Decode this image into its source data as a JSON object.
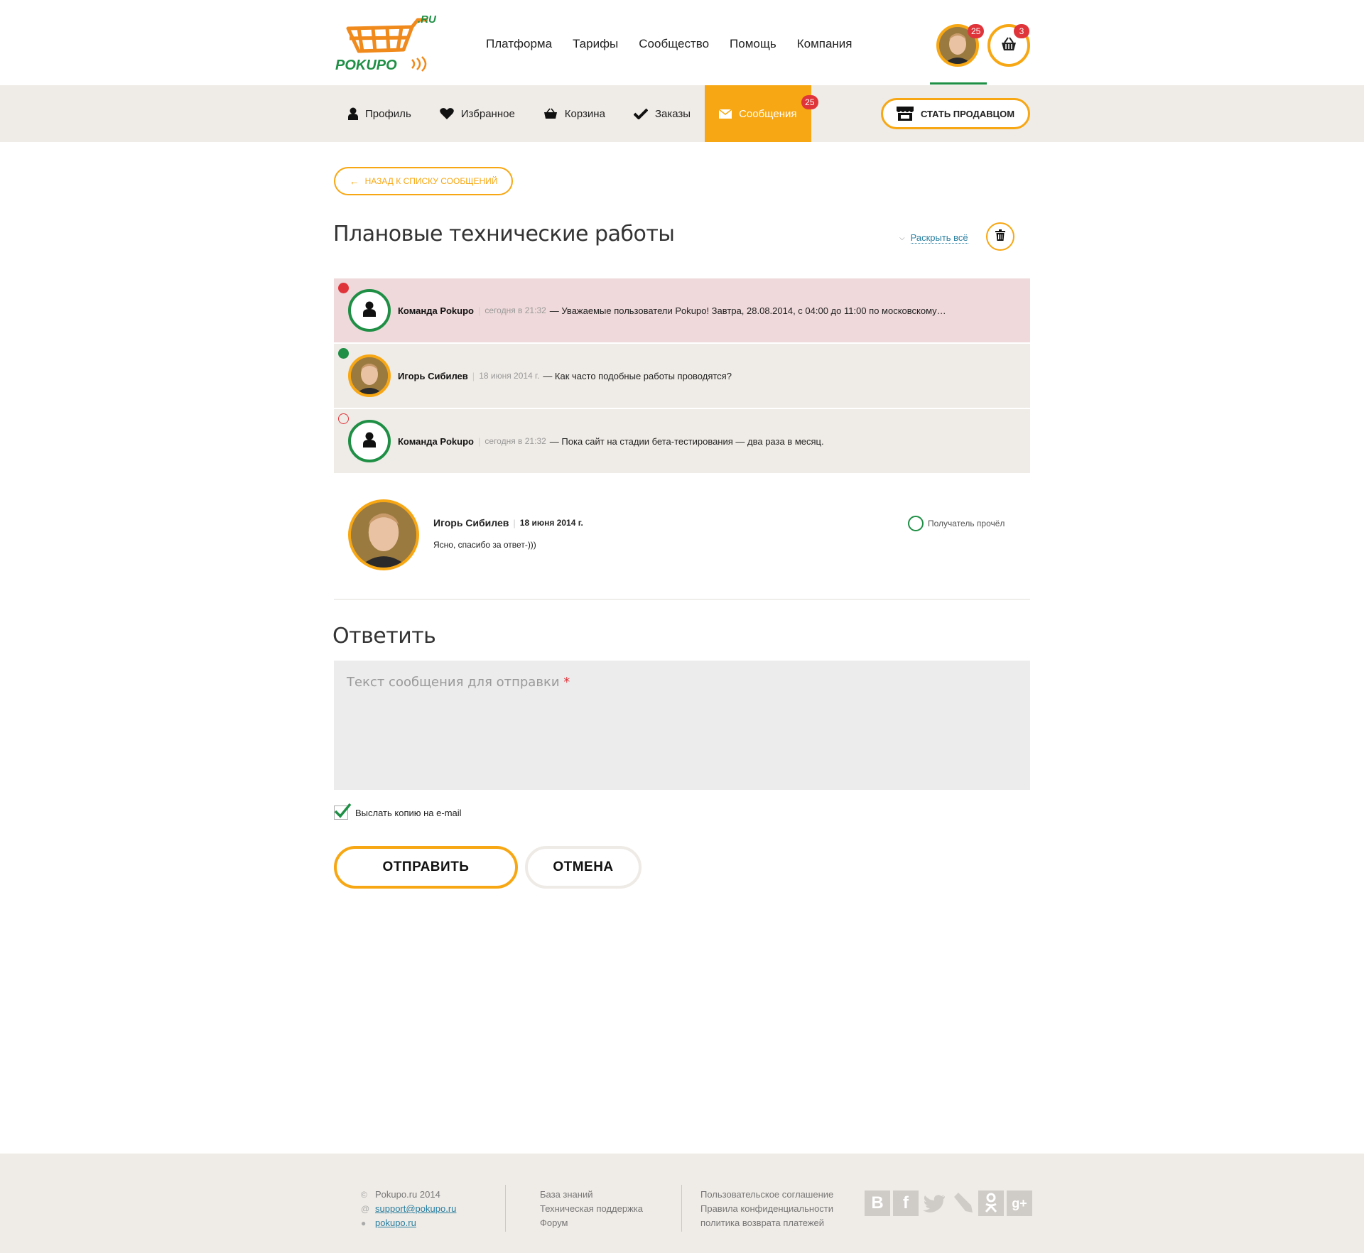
{
  "logo": {
    "text": "POKUPO",
    "suffix": ".RU"
  },
  "topnav": [
    "Платформа",
    "Тарифы",
    "Сообщество",
    "Помощь",
    "Компания"
  ],
  "user": {
    "badge": "25"
  },
  "cart": {
    "badge": "3"
  },
  "subnav": {
    "tabs": [
      {
        "label": "Профиль",
        "icon": "user-icon"
      },
      {
        "label": "Избранное",
        "icon": "heart-icon"
      },
      {
        "label": "Корзина",
        "icon": "basket-icon"
      },
      {
        "label": "Заказы",
        "icon": "check-icon"
      },
      {
        "label": "Сообщения",
        "icon": "envelope-icon",
        "active": true,
        "badge": "25"
      }
    ],
    "seller_button": "СТАТЬ ПРОДАВЦОМ"
  },
  "back_button": "НАЗАД К СПИСКУ СООБЩЕНИЙ",
  "page_title": "Плановые технические работы",
  "expand_all": "Раскрыть всё",
  "thread": [
    {
      "author": "Команда Pokupo",
      "date": "сегодня в 21:32",
      "body": "— Уважаемые пользователи Pokupo! Завтра, 28.08.2014, с 04:00 до 11:00 по московскому…"
    },
    {
      "author": "Игорь Сибилев",
      "date": "18 июня 2014 г.",
      "body": "— Как часто подобные работы проводятся?"
    },
    {
      "author": "Команда Pokupo",
      "date": "сегодня в 21:32",
      "body": "— Пока сайт на стадии бета-тестирования — два раза в месяц."
    }
  ],
  "open_message": {
    "author": "Игорь Сибилев",
    "date": "18 июня 2014 г.",
    "body": "Ясно, спасибо за ответ-)))",
    "read_status": "Получатель прочёл"
  },
  "reply": {
    "title": "Ответить",
    "placeholder": "Текст сообщения для отправки",
    "required_mark": "*",
    "copy_email_label": "Выслать копию на e-mail",
    "copy_email_checked": true,
    "send_label": "ОТПРАВИТЬ",
    "cancel_label": "ОТМЕНА"
  },
  "footer": {
    "copyright": "Pokupo.ru 2014",
    "email": "support@pokupo.ru",
    "skype": "pokupo.ru",
    "col2": [
      "База знаний",
      "Техническая поддержка",
      "Форум"
    ],
    "col3": [
      "Пользовательское соглашение",
      "Правила конфиденциальности",
      "политика возврата платежей"
    ],
    "social": [
      "vk-icon",
      "facebook-icon",
      "twitter-icon",
      "livejournal-icon",
      "odnoklassniki-icon",
      "google-plus-icon"
    ]
  },
  "colors": {
    "accent": "#f7a713",
    "green": "#1e8f45",
    "red": "#e0343b",
    "beige": "#efebe6"
  }
}
